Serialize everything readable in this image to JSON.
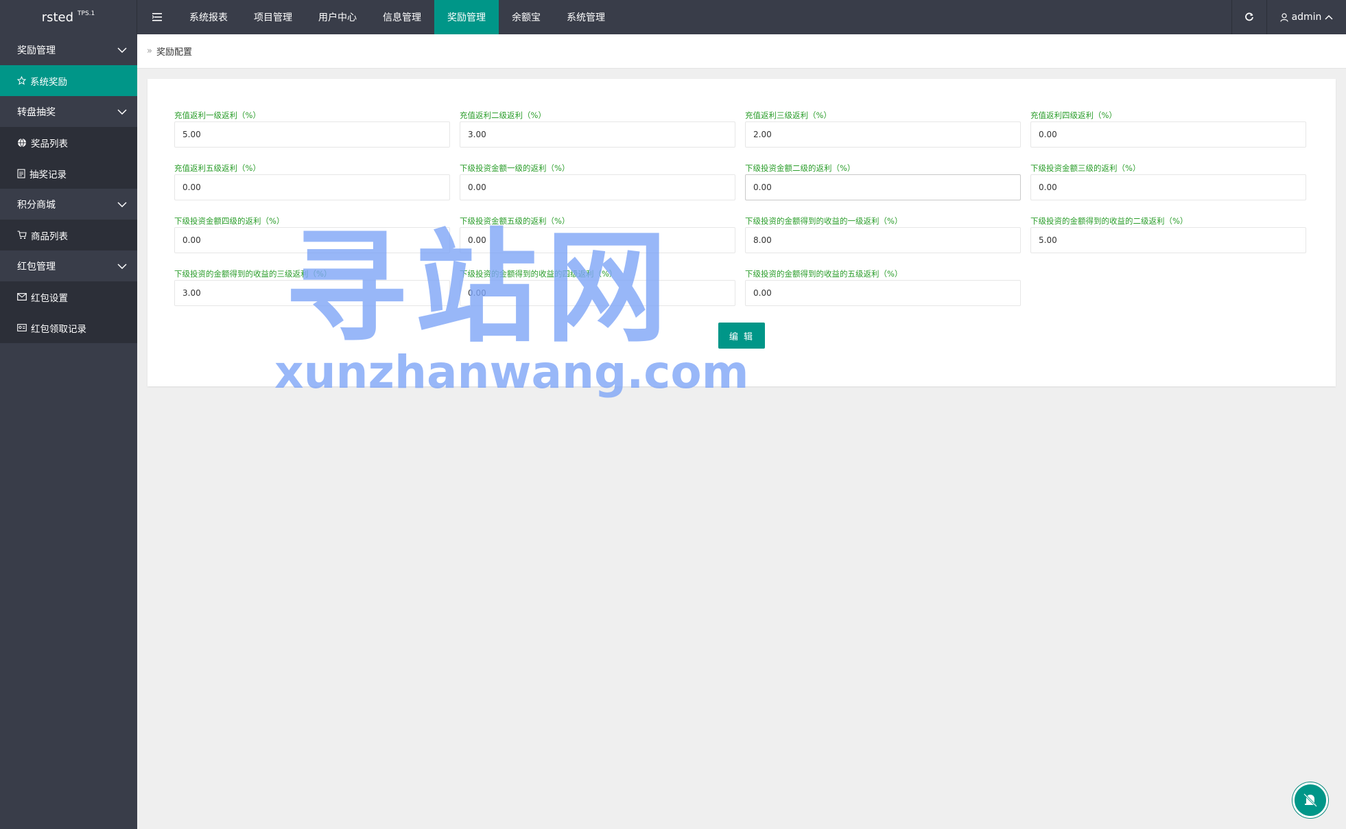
{
  "header": {
    "app_name": "rsted",
    "version": "TPS.1",
    "nav": [
      {
        "label": "系统报表"
      },
      {
        "label": "项目管理"
      },
      {
        "label": "用户中心"
      },
      {
        "label": "信息管理"
      },
      {
        "label": "奖励管理"
      },
      {
        "label": "余额宝"
      },
      {
        "label": "系统管理"
      }
    ],
    "active_nav": "奖励管理",
    "user": "admin"
  },
  "sidebar": {
    "groups": [
      {
        "label": "奖励管理",
        "items": [
          {
            "label": "系统奖励",
            "icon": "star-icon"
          }
        ]
      },
      {
        "label": "转盘抽奖",
        "items": [
          {
            "label": "奖品列表",
            "icon": "globe-icon"
          },
          {
            "label": "抽奖记录",
            "icon": "document-icon"
          }
        ]
      },
      {
        "label": "积分商城",
        "items": [
          {
            "label": "商品列表",
            "icon": "cart-icon"
          }
        ]
      },
      {
        "label": "红包管理",
        "items": [
          {
            "label": "红包设置",
            "icon": "envelope-icon"
          },
          {
            "label": "红包领取记录",
            "icon": "id-card-icon"
          }
        ]
      }
    ],
    "active_item": "系统奖励"
  },
  "breadcrumb": {
    "current": "奖励配置"
  },
  "form": {
    "fields": [
      {
        "label": "充值返利一级返利（%）",
        "value": "5.00"
      },
      {
        "label": "充值返利二级返利（%）",
        "value": "3.00"
      },
      {
        "label": "充值返利三级返利（%）",
        "value": "2.00"
      },
      {
        "label": "充值返利四级返利（%）",
        "value": "0.00"
      },
      {
        "label": "充值返利五级返利（%）",
        "value": "0.00"
      },
      {
        "label": "下级投资金额一级的返利（%）",
        "value": "0.00"
      },
      {
        "label": "下级投资金额二级的返利（%）",
        "value": "0.00"
      },
      {
        "label": "下级投资金额三级的返利（%）",
        "value": "0.00"
      },
      {
        "label": "下级投资金额四级的返利（%）",
        "value": "0.00"
      },
      {
        "label": "下级投资金额五级的返利（%）",
        "value": "0.00"
      },
      {
        "label": "下级投资的金额得到的收益的一级返利（%）",
        "value": "8.00"
      },
      {
        "label": "下级投资的金额得到的收益的二级返利（%）",
        "value": "5.00"
      },
      {
        "label": "下级投资的金额得到的收益的三级返利（%）",
        "value": "3.00"
      },
      {
        "label": "下级投资的金额得到的收益的四级返利（%）",
        "value": "0.00"
      },
      {
        "label": "下级投资的金额得到的收益的五级返利（%）",
        "value": "0.00"
      }
    ],
    "submit_label": "编 辑"
  },
  "watermark": {
    "line1": "寻站网",
    "line2": "xunzhanwang.com"
  },
  "colors": {
    "accent": "#009688",
    "topbar": "#393d49",
    "sidebar_sub": "#2c2f38",
    "label_green": "#2a9d2a"
  }
}
